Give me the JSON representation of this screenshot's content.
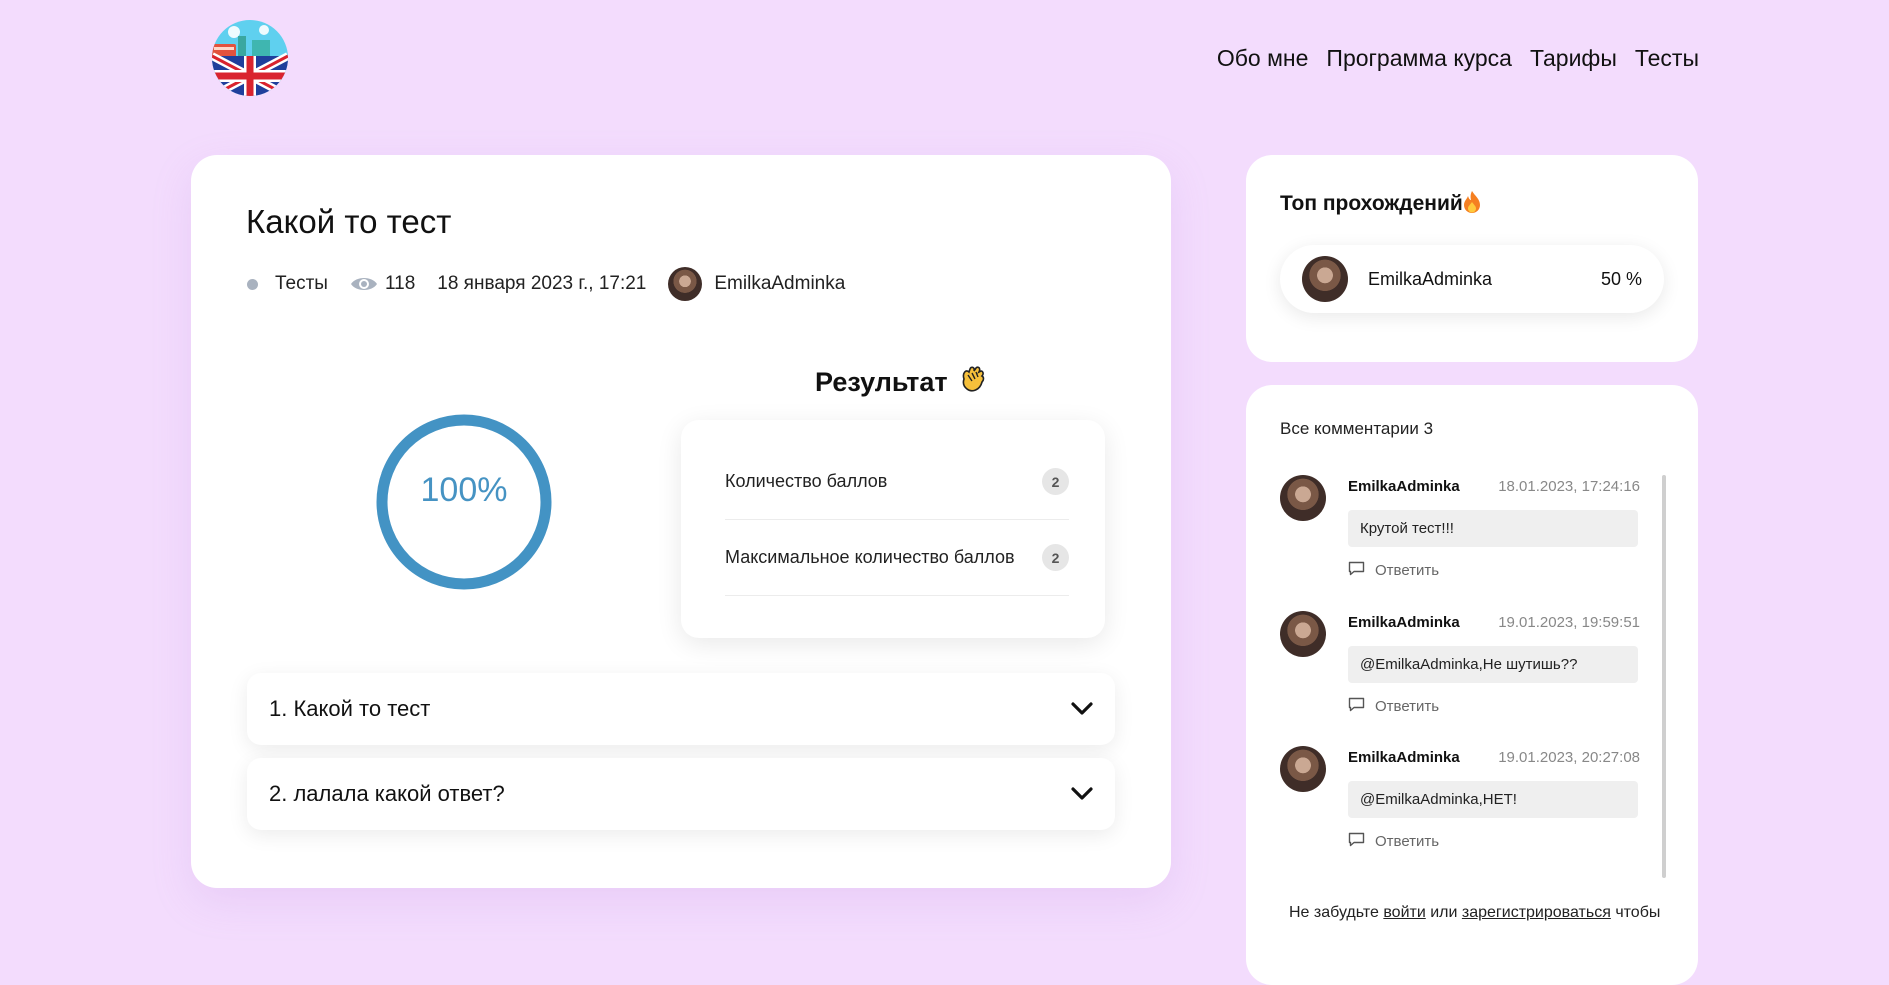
{
  "nav": {
    "items": [
      "Обо мне",
      "Программа курса",
      "Тарифы",
      "Тесты"
    ]
  },
  "test": {
    "title": "Какой то тест",
    "category": "Тесты",
    "views": "118",
    "date": "18 января 2023 г., 17:21",
    "author": "EmilkaAdminka",
    "percent_label": "100%",
    "percent_value": 100
  },
  "result": {
    "title": "Результат",
    "rows": [
      {
        "label": "Количество баллов",
        "value": "2"
      },
      {
        "label": "Максимальное количество баллов",
        "value": "2"
      }
    ]
  },
  "questions": [
    "1. Какой то тест",
    "2. лалала какой ответ?"
  ],
  "top": {
    "title": "Топ прохождений",
    "entries": [
      {
        "name": "EmilkaAdminka",
        "score": "50 %"
      }
    ]
  },
  "comments": {
    "heading": "Все комментарии",
    "count": "3",
    "reply_label": "Ответить",
    "items": [
      {
        "author": "EmilkaAdminka",
        "date": "18.01.2023, 17:24:16",
        "text": "Крутой тест!!!"
      },
      {
        "author": "EmilkaAdminka",
        "date": "19.01.2023, 19:59:51",
        "text": "@EmilkaAdminka,Не шутишь??"
      },
      {
        "author": "EmilkaAdminka",
        "date": "19.01.2023, 20:27:08",
        "text": "@EmilkaAdminka,HET!"
      }
    ],
    "footer": {
      "prefix": "Не забудьте",
      "login": "войти",
      "middle": "или",
      "register": "зарегистрироваться",
      "suffix": "чтобы"
    }
  },
  "colors": {
    "page_bg": "#f3dcfd",
    "accent": "#4693c3"
  },
  "icons": {
    "views": "eye-icon",
    "reply": "speech-bubble-icon",
    "expand": "chevron-down-icon",
    "fire": "fire-icon",
    "clap": "clapping-hands-icon"
  }
}
